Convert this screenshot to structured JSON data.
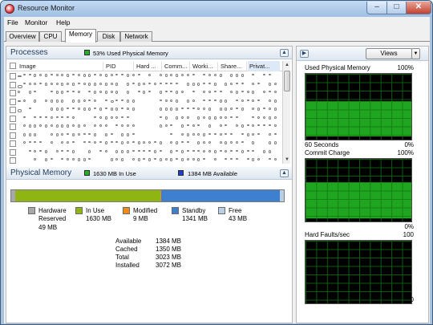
{
  "window": {
    "title": "Resource Monitor"
  },
  "menu": {
    "file": "File",
    "monitor": "Monitor",
    "help": "Help"
  },
  "tabs": [
    "Overview",
    "CPU",
    "Memory",
    "Disk",
    "Network"
  ],
  "processes": {
    "title": "Processes",
    "summary": "53% Used Physical Memory",
    "summary_color": "#22b122",
    "columns": [
      "Image",
      "PID",
      "Hard ...",
      "Comm...",
      "Worki...",
      "Share...",
      "Privat..."
    ]
  },
  "physical_memory": {
    "title": "Physical Memory",
    "in_use_summary": "1630 MB In Use",
    "available_summary": "1384 MB Available",
    "bar": {
      "hardware_reserved": 0.016,
      "in_use": 0.531,
      "modified": 0.003,
      "standby": 0.436,
      "free": 0.014
    },
    "legend": [
      {
        "label": "Hardware",
        "label2": "Reserved",
        "value": "49 MB",
        "color": "#a8a8a8"
      },
      {
        "label": "In Use",
        "value": "1630 MB",
        "color": "#8fb512"
      },
      {
        "label": "Modified",
        "value": "9 MB",
        "color": "#f08a18"
      },
      {
        "label": "Standby",
        "value": "1341 MB",
        "color": "#3f7fcf"
      },
      {
        "label": "Free",
        "value": "43 MB",
        "color": "#b9cfe4"
      }
    ],
    "stats": [
      {
        "label": "Available",
        "value": "1384 MB"
      },
      {
        "label": "Cached",
        "value": "1350 MB"
      },
      {
        "label": "Total",
        "value": "3023 MB"
      },
      {
        "label": "Installed",
        "value": "3072 MB"
      }
    ]
  },
  "graphs": {
    "views_label": "Views",
    "used_physical": {
      "title": "Used Physical Memory",
      "max": "100%",
      "min": "0%",
      "footer": "60 Seconds",
      "level": 0.53
    },
    "commit_charge": {
      "title": "Commit Charge",
      "max": "100%",
      "min": "0%",
      "level": 0.58
    },
    "hard_faults": {
      "title": "Hard Faults/sec",
      "max": "100",
      "min": "0",
      "level": 0.0
    }
  }
}
